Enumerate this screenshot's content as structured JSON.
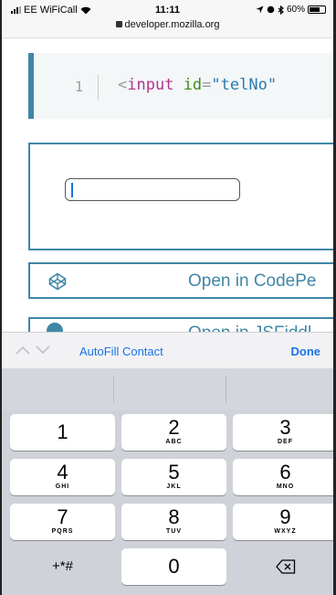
{
  "status_bar": {
    "carrier": "EE WiFiCall",
    "time": "11:11",
    "battery": "60%",
    "url": "developer.mozilla.org"
  },
  "code": {
    "line_number": "1",
    "open": "<",
    "tag": "input",
    "attr": "id",
    "eq": "=",
    "value": "\"telNo\""
  },
  "buttons": {
    "codepen": "Open in CodePe",
    "jsfiddle": "Open in JSFiddl"
  },
  "accessory": {
    "autofill": "AutoFill Contact",
    "done": "Done"
  },
  "keys": [
    {
      "digit": "1",
      "letters": ""
    },
    {
      "digit": "2",
      "letters": "ABC"
    },
    {
      "digit": "3",
      "letters": "DEF"
    },
    {
      "digit": "4",
      "letters": "GHI"
    },
    {
      "digit": "5",
      "letters": "JKL"
    },
    {
      "digit": "6",
      "letters": "MNO"
    },
    {
      "digit": "7",
      "letters": "PQRS"
    },
    {
      "digit": "8",
      "letters": "TUV"
    },
    {
      "digit": "9",
      "letters": "WXYZ"
    },
    {
      "digit": "+*#",
      "letters": ""
    },
    {
      "digit": "0",
      "letters": ""
    }
  ],
  "icons": {
    "codepen": "codepen-icon",
    "jsfiddle": "jsfiddle-icon",
    "delete": "delete-icon"
  },
  "colors": {
    "mdn_blue": "#3f87a6",
    "ios_blue": "#1a73e8"
  }
}
